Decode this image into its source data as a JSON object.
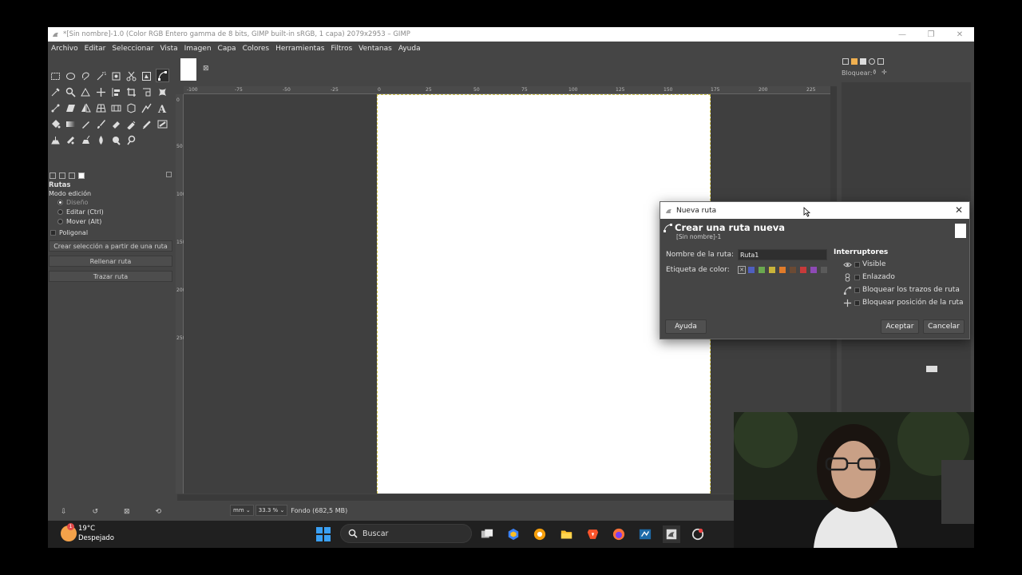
{
  "window": {
    "title": "*[Sin nombre]-1.0 (Color RGB Entero gamma de 8 bits, GIMP built-in sRGB, 1 capa) 2079x2953 – GIMP"
  },
  "menu": [
    "Archivo",
    "Editar",
    "Seleccionar",
    "Vista",
    "Imagen",
    "Capa",
    "Colores",
    "Herramientas",
    "Filtros",
    "Ventanas",
    "Ayuda"
  ],
  "tool_options": {
    "title": "Rutas",
    "mode_label": "Modo edición",
    "modes": [
      "Diseño",
      "Editar (Ctrl)",
      "Mover (Alt)"
    ],
    "polygonal": "Poligonal",
    "buttons": [
      "Crear selección a partir de una ruta",
      "Rellenar ruta",
      "Trazar ruta"
    ]
  },
  "rulers": {
    "h": [
      "-100",
      "-75",
      "-50",
      "-25",
      "0",
      "25",
      "50",
      "75",
      "100",
      "125",
      "150",
      "175",
      "200",
      "225"
    ],
    "v": [
      "0",
      "50",
      "100",
      "150",
      "200",
      "250"
    ]
  },
  "status": {
    "unit": "mm",
    "zoom": "33.3 %",
    "message": "Fondo (682,5 MB)"
  },
  "right_dock": {
    "lock_label": "Bloquear:"
  },
  "dialog": {
    "title": "Nueva ruta",
    "heading": "Crear una ruta nueva",
    "subheading": "[Sin nombre]-1",
    "name_label": "Nombre de la ruta:",
    "name_value": "Ruta1",
    "color_label": "Etiqueta de color:",
    "color_swatches": [
      "#4f5fbf",
      "#6aa84f",
      "#c9b43a",
      "#e07b2a",
      "#6b4a34",
      "#c73a3a",
      "#8e4ab5",
      "#5a5a5a"
    ],
    "switches_heading": "Interruptores",
    "switches": [
      {
        "icon": "eye-icon",
        "label": "Visible"
      },
      {
        "icon": "chain-icon",
        "label": "Enlazado"
      },
      {
        "icon": "brush-lock-icon",
        "label": "Bloquear los trazos de ruta"
      },
      {
        "icon": "move-lock-icon",
        "label": "Bloquear posición de la ruta"
      }
    ],
    "help_label": "Ayuda",
    "accept_label": "Aceptar",
    "cancel_label": "Cancelar"
  },
  "taskbar": {
    "weather_badge": "1",
    "weather_temp": "19°C",
    "weather_desc": "Despejado",
    "search_label": "Buscar"
  }
}
